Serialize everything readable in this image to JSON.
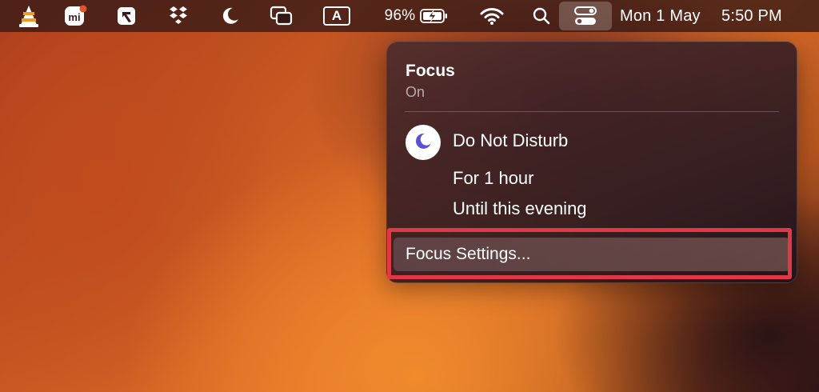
{
  "menubar": {
    "icons": [
      "vlc-icon",
      "mindmap-app-icon",
      "pointer-app-icon",
      "dropbox-icon",
      "focus-moon-icon",
      "window-tiling-icon",
      "input-source-icon",
      "battery-charging-icon",
      "wifi-icon",
      "spotlight-search-icon",
      "control-center-icon"
    ],
    "input_source": "A",
    "battery_percent": "96%",
    "date": "Mon 1 May",
    "time": "5:50 PM"
  },
  "focus_panel": {
    "title": "Focus",
    "status": "On",
    "mode": {
      "icon": "moon-icon",
      "label": "Do Not Disturb",
      "options": [
        "For 1 hour",
        "Until this evening"
      ]
    },
    "settings_label": "Focus Settings..."
  },
  "colors": {
    "highlight": "#e03844",
    "moon": "#5b4fd6"
  }
}
